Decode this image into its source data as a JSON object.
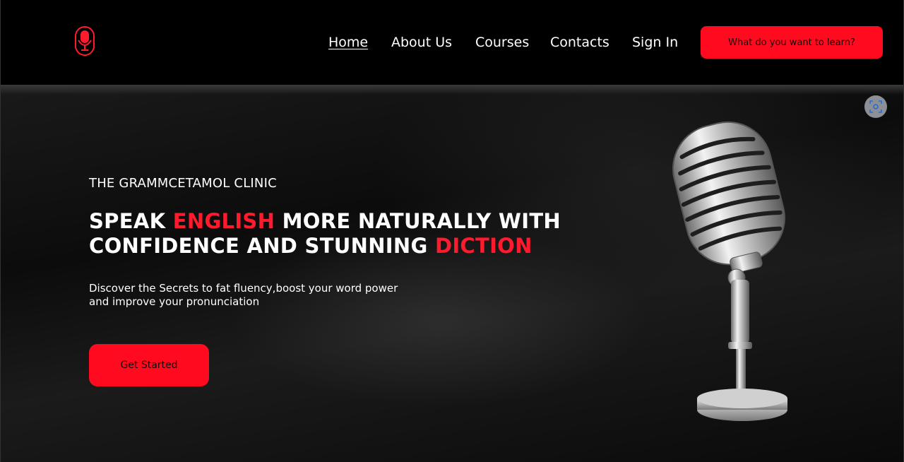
{
  "nav": {
    "links": [
      "Home",
      "About Us",
      "Courses",
      "Contacts",
      "Sign In"
    ],
    "cta_label": "What do you want to learn?"
  },
  "hero": {
    "eyebrow": "THE GRAMMCETAMOL CLINIC",
    "headline_parts": {
      "p1": "SPEAK ",
      "p2": "ENGLISH",
      "p3": " MORE NATURALLY WITH",
      "p4": "CONFIDENCE AND STUNNING ",
      "p5": "DICTION"
    },
    "subtext_line1": "Discover the Secrets to fat fluency,boost your word power",
    "subtext_line2": "and improve your pronunciation",
    "button_label": "Get Started"
  },
  "colors": {
    "accent": "#ff0a1f",
    "background": "#000000"
  },
  "icons": {
    "logo": "microphone-logo-icon",
    "screenshot": "screen-capture-icon",
    "hero_image": "microphone-image"
  }
}
